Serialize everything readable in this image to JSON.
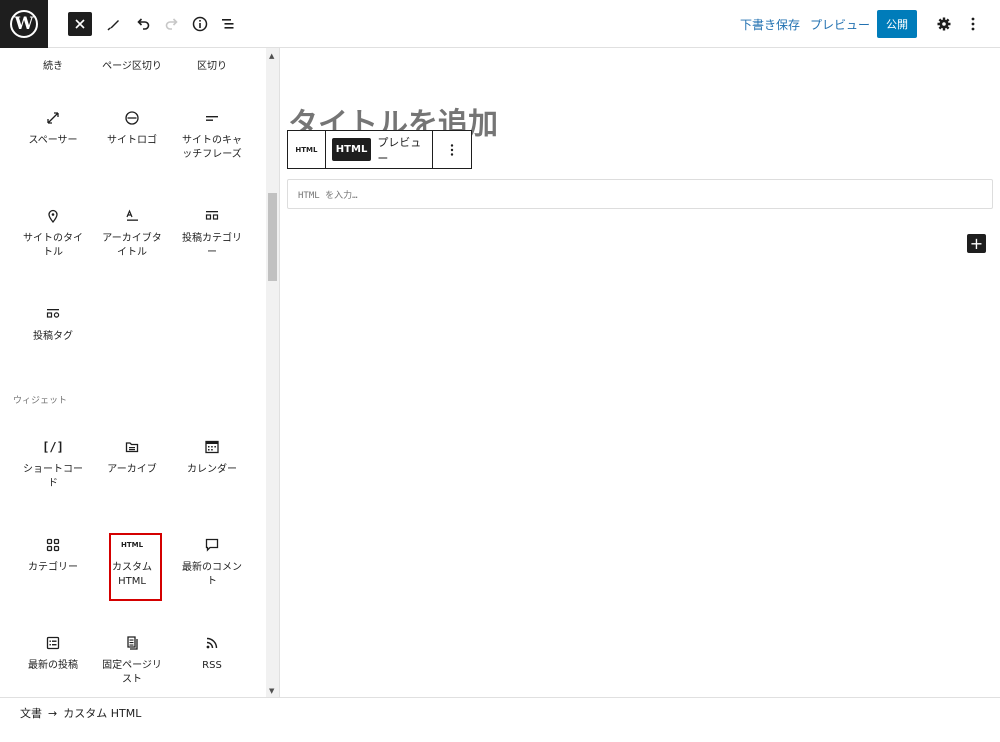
{
  "header": {
    "save_draft": "下書き保存",
    "preview": "プレビュー",
    "publish": "公開"
  },
  "inserter": {
    "top_partial": [
      "続き",
      "ページ区切り",
      "区切り"
    ],
    "theme_blocks": [
      {
        "label": "スペーサー",
        "icon": "resize-icon"
      },
      {
        "label": "サイトロゴ",
        "icon": "site-logo-icon"
      },
      {
        "label": "サイトのキャッチフレーズ",
        "icon": "tagline-icon"
      },
      {
        "label": "サイトのタイトル",
        "icon": "map-marker-icon"
      },
      {
        "label": "アーカイブタイトル",
        "icon": "archive-title-icon"
      },
      {
        "label": "投稿カテゴリー",
        "icon": "post-terms-icon"
      },
      {
        "label": "投稿タグ",
        "icon": "post-terms-icon"
      }
    ],
    "widgets_title": "ウィジェット",
    "widget_blocks": [
      {
        "label": "ショートコード",
        "icon": "shortcode-icon",
        "glyph": "[/]"
      },
      {
        "label": "アーカイブ",
        "icon": "archive-icon"
      },
      {
        "label": "カレンダー",
        "icon": "calendar-icon"
      },
      {
        "label": "カテゴリー",
        "icon": "categories-icon"
      },
      {
        "label": "カスタム HTML",
        "icon": "html-icon",
        "glyph": "HTML",
        "highlighted": true
      },
      {
        "label": "最新のコメント",
        "icon": "comment-icon"
      },
      {
        "label": "最新の投稿",
        "icon": "post-list-icon"
      },
      {
        "label": "固定ページリスト",
        "icon": "pages-icon"
      },
      {
        "label": "RSS",
        "icon": "rss-icon"
      }
    ]
  },
  "editor": {
    "title_placeholder": "タイトルを追加",
    "toolbar": {
      "block_icon": "HTML",
      "html_tab": "HTML",
      "preview_tab": "プレビュー"
    },
    "html_placeholder": "HTML を入力…"
  },
  "footer": {
    "breadcrumb": [
      "文書",
      "カスタム HTML"
    ],
    "separator": "→"
  }
}
